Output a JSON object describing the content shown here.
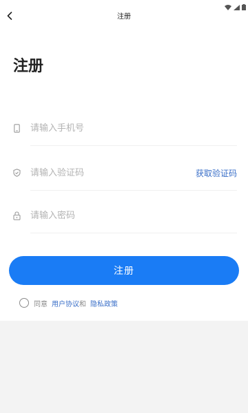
{
  "nav": {
    "title": "注册"
  },
  "page": {
    "title": "注册"
  },
  "form": {
    "phone": {
      "placeholder": "请输入手机号",
      "icon": "phone-icon"
    },
    "code": {
      "placeholder": "请输入验证码",
      "icon": "shield-icon",
      "action_label": "获取验证码"
    },
    "password": {
      "placeholder": "请输入密码",
      "icon": "lock-icon"
    }
  },
  "actions": {
    "register_label": "注册"
  },
  "agreement": {
    "prefix": "同意",
    "user_agreement": "用户协议",
    "conjunction": "和",
    "privacy_policy": "隐私政策"
  },
  "colors": {
    "accent": "#1a7cf5",
    "link": "#3a6fc8",
    "placeholder": "#b3b3b3",
    "background_bottom": "#f3f3f3"
  }
}
